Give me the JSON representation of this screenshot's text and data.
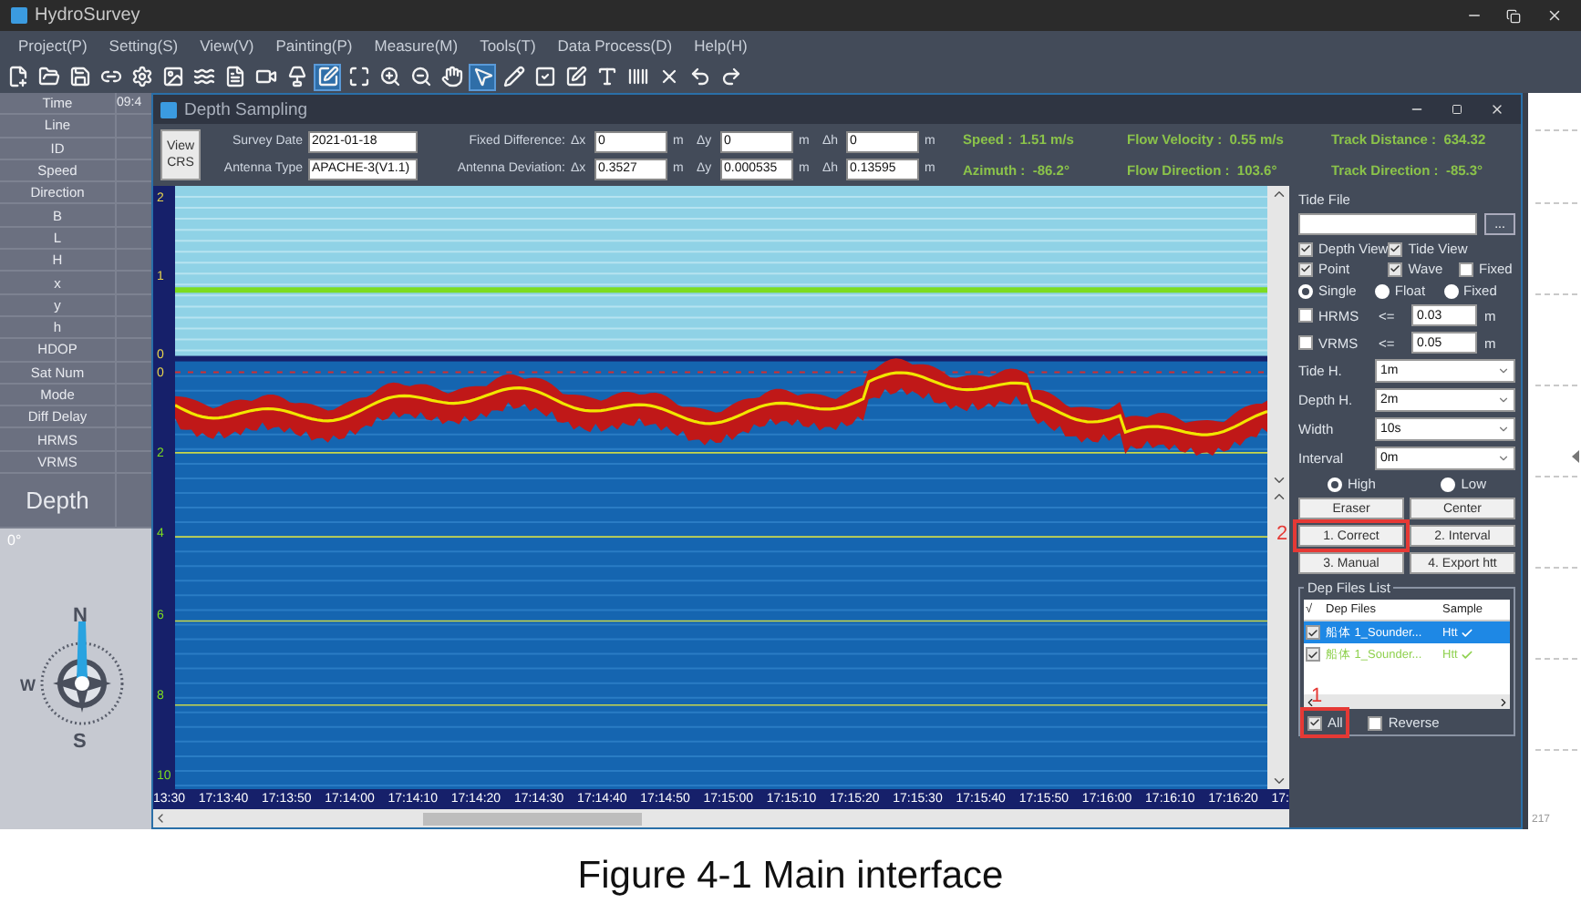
{
  "app": {
    "title": "HydroSurvey"
  },
  "menu": [
    "Project(P)",
    "Setting(S)",
    "View(V)",
    "Painting(P)",
    "Measure(M)",
    "Tools(T)",
    "Data Process(D)",
    "Help(H)"
  ],
  "toolbar": [
    {
      "selected": false
    },
    {
      "selected": false
    },
    {
      "selected": false
    },
    {
      "selected": false
    },
    {
      "selected": false
    },
    {
      "selected": false
    },
    {
      "selected": false
    },
    {
      "selected": false
    },
    {
      "selected": false
    },
    {
      "selected": false
    },
    {
      "selected": true
    },
    {
      "selected": false
    },
    {
      "selected": false
    },
    {
      "selected": false
    },
    {
      "selected": false
    },
    {
      "selected": true
    },
    {
      "selected": false
    },
    {
      "selected": false
    },
    {
      "selected": false
    },
    {
      "selected": false
    },
    {
      "selected": false
    },
    {
      "selected": false
    },
    {
      "selected": false
    },
    {
      "selected": false
    }
  ],
  "info_panel": {
    "rows": [
      {
        "label": "Time",
        "value": "09:4",
        "kind": "normal"
      },
      {
        "label": "Line",
        "kind": "normal"
      },
      {
        "label": "ID",
        "kind": "normal"
      },
      {
        "label": "Speed",
        "kind": "normal"
      },
      {
        "label": "Direction",
        "kind": "normal"
      },
      {
        "label": "B",
        "kind": "normal"
      },
      {
        "label": "L",
        "kind": "normal"
      },
      {
        "label": "H",
        "kind": "normal"
      },
      {
        "label": "x",
        "kind": "normal"
      },
      {
        "label": "y",
        "kind": "normal"
      },
      {
        "label": "h",
        "kind": "normal"
      },
      {
        "label": "HDOP",
        "kind": "normal"
      },
      {
        "label": "Sat Num",
        "kind": "normal"
      },
      {
        "label": "Mode",
        "kind": "normal"
      },
      {
        "label": "Diff Delay",
        "kind": "normal"
      },
      {
        "label": "HRMS",
        "kind": "normal"
      },
      {
        "label": "VRMS",
        "kind": "normal"
      },
      {
        "label": "Depth",
        "kind": "large"
      }
    ],
    "compass": {
      "heading": "0°",
      "north": "N",
      "west": "W",
      "south": "S"
    }
  },
  "depth_window": {
    "title": "Depth Sampling",
    "view_crs": "View CRS",
    "survey_date": {
      "label": "Survey Date",
      "value": "2021-01-18"
    },
    "antenna_type": {
      "label": "Antenna Type",
      "value": "APACHE-3(V1.1)"
    },
    "fixed_difference": {
      "label": "Fixed Difference:",
      "fields": [
        {
          "axis": "Δx",
          "value": "0",
          "unit": "m"
        },
        {
          "axis": "Δy",
          "value": "0",
          "unit": "m"
        },
        {
          "axis": "Δh",
          "value": "0",
          "unit": "m"
        }
      ]
    },
    "antenna_deviation": {
      "label": "Antenna Deviation:",
      "fields": [
        {
          "axis": "Δx",
          "value": "0.3527",
          "unit": "m"
        },
        {
          "axis": "Δy",
          "value": "0.000535",
          "unit": "m"
        },
        {
          "axis": "Δh",
          "value": "0.13595",
          "unit": "m"
        }
      ]
    },
    "stats": [
      {
        "label": "Speed :",
        "value": "1.51 m/s"
      },
      {
        "label": "Flow Velocity :",
        "value": "0.55 m/s"
      },
      {
        "label": "Track Distance :",
        "value": "634.32"
      },
      {
        "label": "Azimuth :",
        "value": "-86.2°"
      },
      {
        "label": "Flow Direction :",
        "value": "103.6°"
      },
      {
        "label": "Track Direction :",
        "value": "-85.3°"
      }
    ]
  },
  "chart": {
    "tide_axis": [
      "2",
      "1",
      "0"
    ],
    "depth_axis": [
      "0",
      "2",
      "4",
      "6",
      "8",
      "10"
    ],
    "time_labels": [
      "13:30",
      "17:13:40",
      "17:13:50",
      "17:14:00",
      "17:14:10",
      "17:14:20",
      "17:14:30",
      "17:14:40",
      "17:14:50",
      "17:15:00",
      "17:15:10",
      "17:15:20",
      "17:15:30",
      "17:15:40",
      "17:15:50",
      "17:16:00",
      "17:16:10",
      "17:16:20",
      "17:"
    ]
  },
  "side_panel": {
    "tide_file": {
      "label": "Tide File",
      "browse": "..."
    },
    "view_options": [
      {
        "label": "Depth View",
        "checked": true
      },
      {
        "label": "Tide View",
        "checked": true
      },
      {
        "label": "Point",
        "checked": true
      },
      {
        "label": "Wave",
        "checked": true
      },
      {
        "label": "Fixed",
        "checked": false
      }
    ],
    "solution": [
      {
        "label": "Single",
        "selected": true
      },
      {
        "label": "Float",
        "selected": false
      },
      {
        "label": "Fixed",
        "selected": false
      }
    ],
    "limits": [
      {
        "label": "HRMS",
        "checked": false,
        "operator": "<=",
        "value": "0.03",
        "unit": "m"
      },
      {
        "label": "VRMS",
        "checked": false,
        "operator": "<=",
        "value": "0.05",
        "unit": "m"
      }
    ],
    "selects": [
      {
        "label": "Tide H.",
        "value": "1m"
      },
      {
        "label": "Depth H.",
        "value": "2m"
      },
      {
        "label": "Width",
        "value": "10s"
      },
      {
        "label": "Interval",
        "value": "0m"
      }
    ],
    "level": [
      {
        "label": "High",
        "selected": true
      },
      {
        "label": "Low",
        "selected": false
      }
    ],
    "buttons": [
      {
        "label": "Eraser"
      },
      {
        "label": "Center"
      },
      {
        "label": "1. Correct",
        "marker": "2"
      },
      {
        "label": "2. Interval"
      },
      {
        "label": "3. Manual"
      },
      {
        "label": "4. Export htt"
      }
    ],
    "files": {
      "title": "Dep Files List",
      "columns": [
        "√",
        "Dep Files",
        "Sample"
      ],
      "rows": [
        {
          "checked": true,
          "selected": true,
          "name": "船体 1_Sounder...",
          "sample": "Htt",
          "color": "#ffffff"
        },
        {
          "checked": true,
          "selected": false,
          "name": "船体 1_Sounder...",
          "sample": "Htt",
          "color": "#8fd14f"
        }
      ]
    },
    "select_all": {
      "label": "All",
      "checked": true,
      "marker": "1"
    },
    "reverse": {
      "label": "Reverse",
      "checked": false
    }
  },
  "page_number": "217",
  "caption": "Figure 4-1 Main interface"
}
